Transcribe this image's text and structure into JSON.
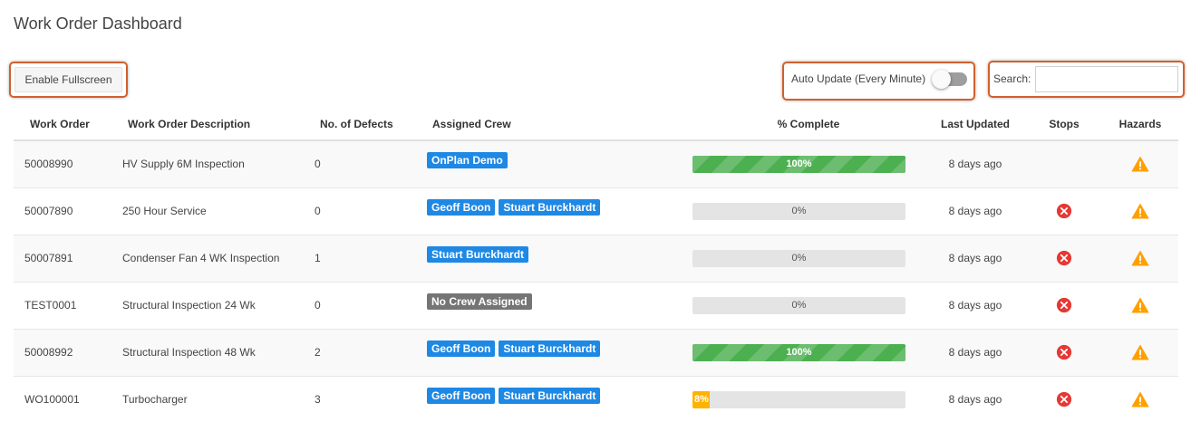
{
  "page": {
    "title": "Work Order Dashboard"
  },
  "toolbar": {
    "fullscreen_label": "Enable Fullscreen",
    "auto_update_label": "Auto Update (Every Minute)",
    "auto_update_on": false,
    "search_label": "Search:",
    "search_value": ""
  },
  "table": {
    "headers": [
      "Work Order",
      "Work Order Description",
      "No. of Defects",
      "Assigned Crew",
      "% Complete",
      "Last Updated",
      "Stops",
      "Hazards"
    ],
    "rows": [
      {
        "wo": "50008990",
        "desc": "HV Supply 6M Inspection",
        "defects": "0",
        "crew": [
          "OnPlan Demo"
        ],
        "crew_none": false,
        "pct": 100,
        "pct_label": "100%",
        "updated": "8 days ago",
        "stop": false,
        "hazard": true
      },
      {
        "wo": "50007890",
        "desc": "250 Hour Service",
        "defects": "0",
        "crew": [
          "Geoff Boon",
          "Stuart Burckhardt"
        ],
        "crew_none": false,
        "pct": 0,
        "pct_label": "0%",
        "updated": "8 days ago",
        "stop": true,
        "hazard": true
      },
      {
        "wo": "50007891",
        "desc": "Condenser Fan 4 WK Inspection",
        "defects": "1",
        "crew": [
          "Stuart Burckhardt"
        ],
        "crew_none": false,
        "pct": 0,
        "pct_label": "0%",
        "updated": "8 days ago",
        "stop": true,
        "hazard": true
      },
      {
        "wo": "TEST0001",
        "desc": "Structural Inspection 24 Wk",
        "defects": "0",
        "crew": [
          "No Crew Assigned"
        ],
        "crew_none": true,
        "pct": 0,
        "pct_label": "0%",
        "updated": "8 days ago",
        "stop": true,
        "hazard": true
      },
      {
        "wo": "50008992",
        "desc": "Structural Inspection 48 Wk",
        "defects": "2",
        "crew": [
          "Geoff Boon",
          "Stuart Burckhardt"
        ],
        "crew_none": false,
        "pct": 100,
        "pct_label": "100%",
        "updated": "8 days ago",
        "stop": true,
        "hazard": true
      },
      {
        "wo": "WO100001",
        "desc": "Turbocharger",
        "defects": "3",
        "crew": [
          "Geoff Boon",
          "Stuart Burckhardt"
        ],
        "crew_none": false,
        "pct": 8,
        "pct_label": "8%",
        "updated": "8 days ago",
        "stop": true,
        "hazard": true
      }
    ]
  },
  "colors": {
    "crew_badge": "#1e88e5",
    "crew_none_badge": "#757575",
    "progress_complete": "#4caf50",
    "progress_partial": "#ffb300",
    "stop_icon": "#e53935",
    "hazard_icon": "#ffa000",
    "highlight_border": "#d0612e"
  },
  "icons": {
    "stop": "error-circle-x-icon",
    "hazard": "warning-triangle-icon"
  }
}
